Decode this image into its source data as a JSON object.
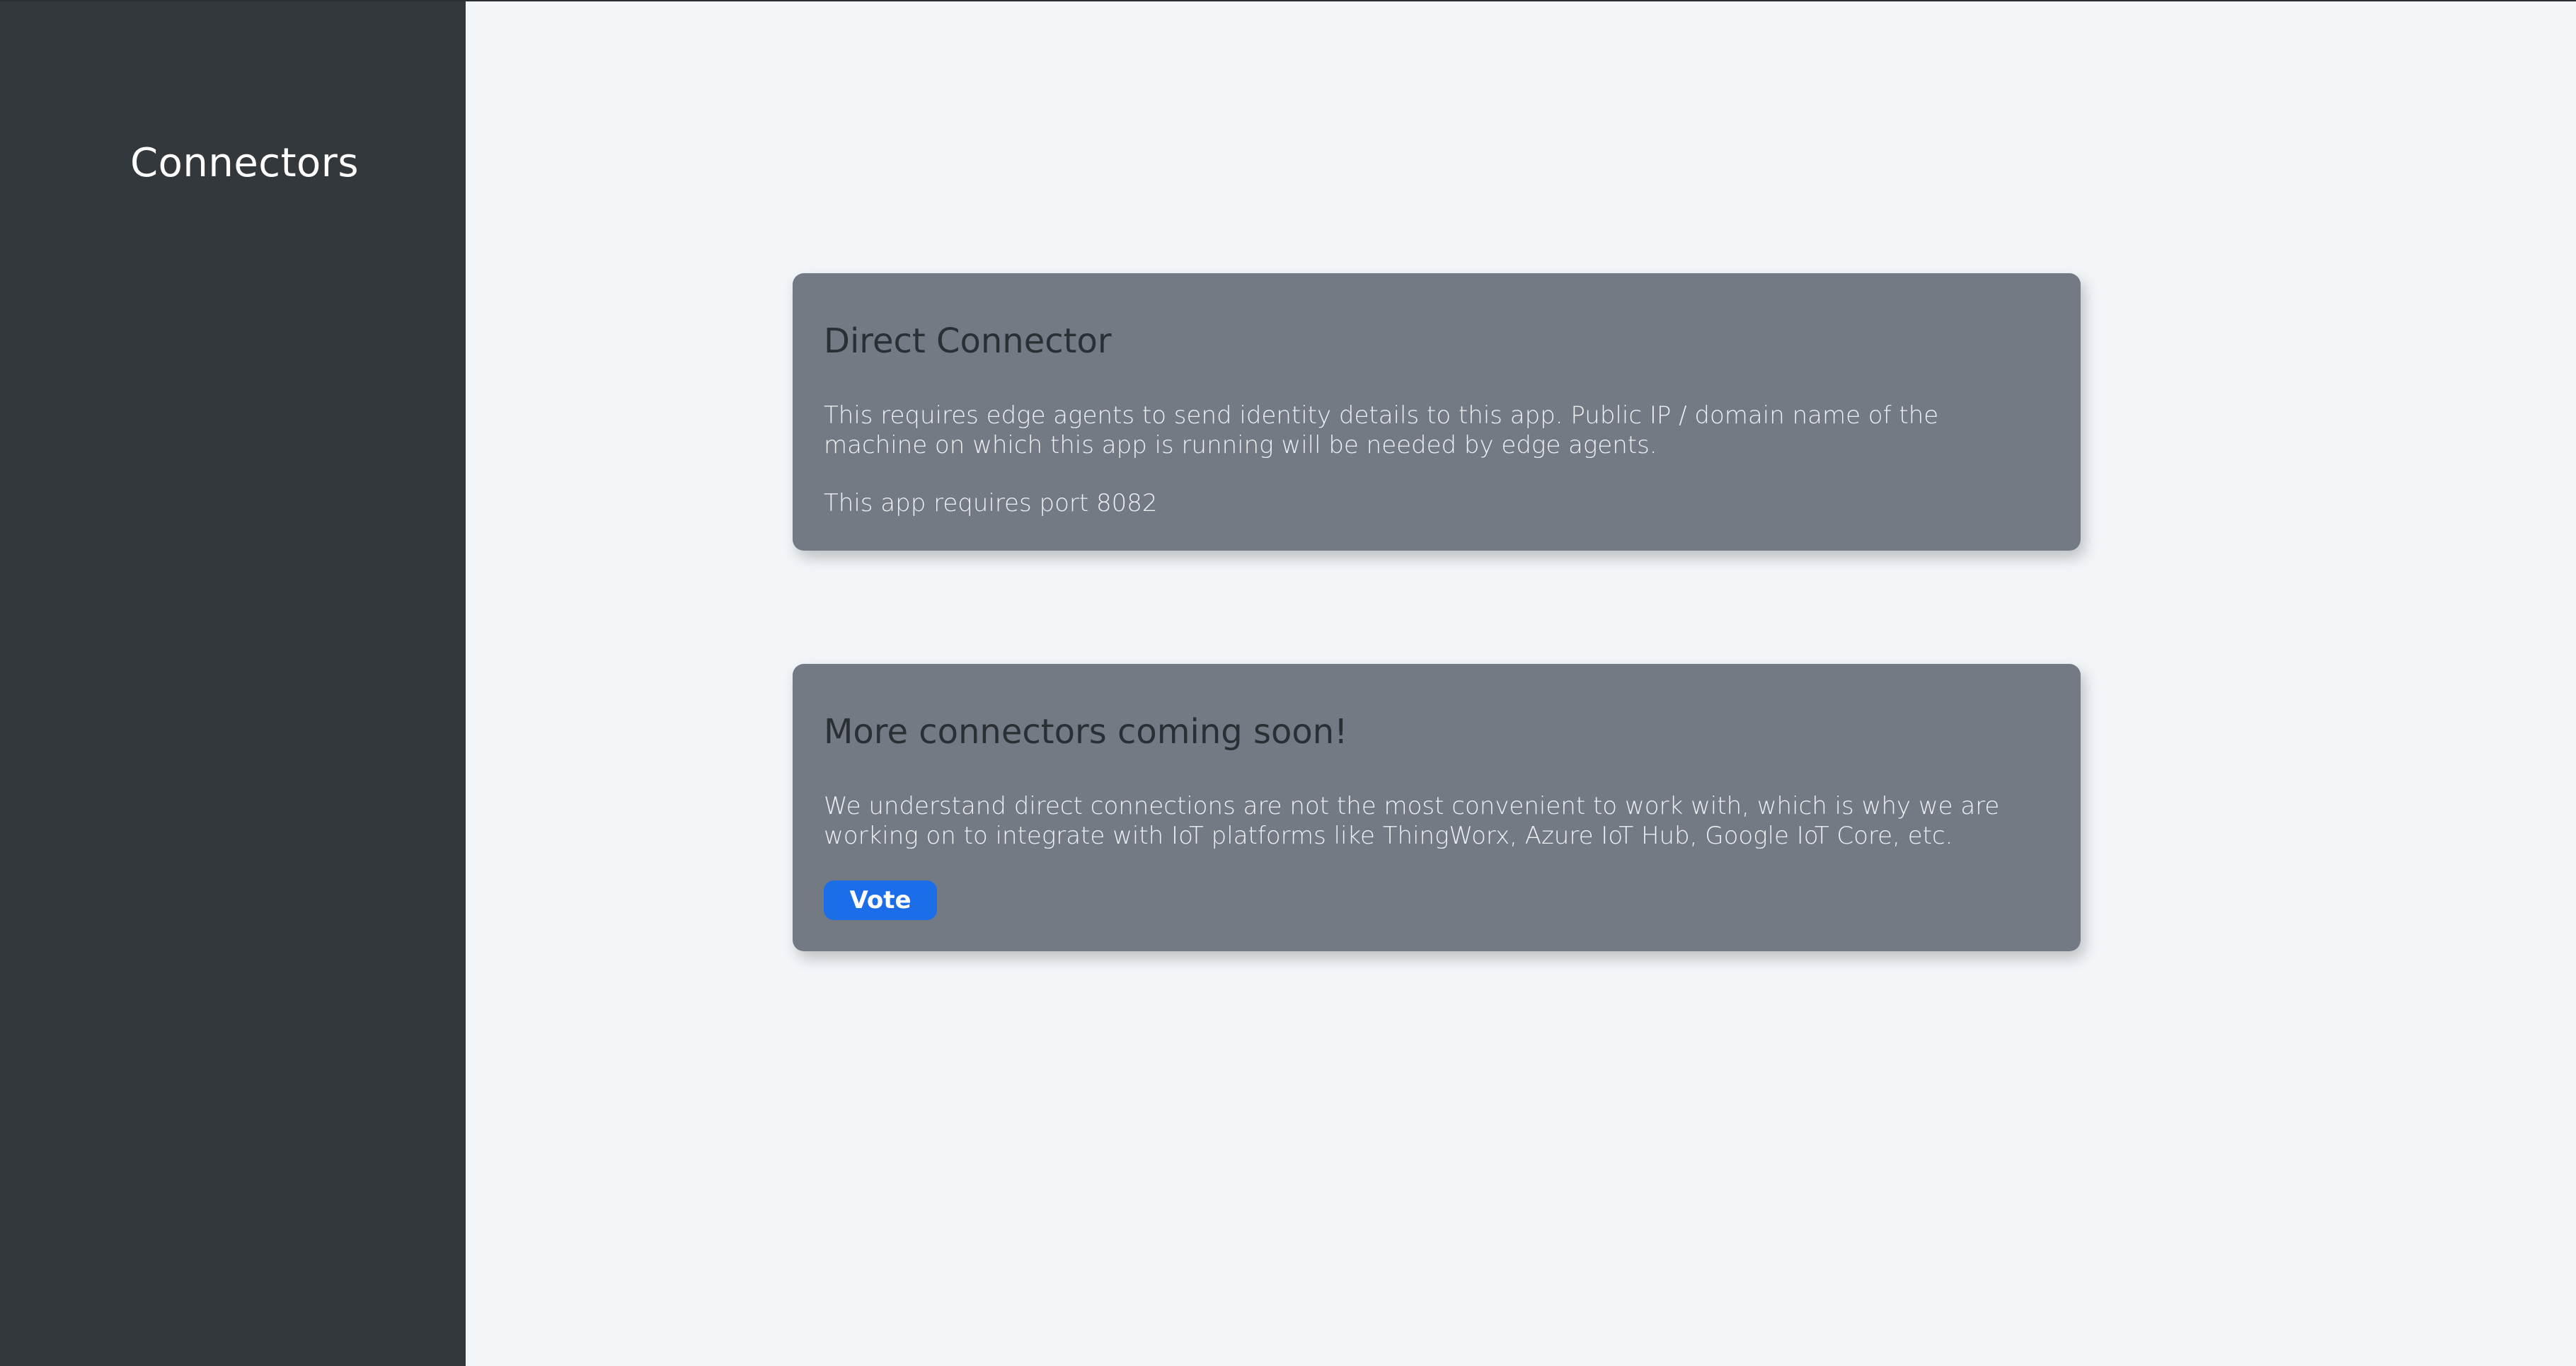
{
  "sidebar": {
    "title": "Connectors"
  },
  "cards": {
    "direct": {
      "title": "Direct Connector",
      "description": "This requires edge agents to send identity details to this app. Public IP / domain name of the machine on which this app is running will be needed by edge agents.",
      "port_note": "This app requires port 8082"
    },
    "more": {
      "title": "More connectors coming soon!",
      "description": "We understand direct connections are not the most convenient to work with, which is why we are working on to integrate with IoT platforms like ThingWorx, Azure IoT Hub, Google IoT Core, etc.",
      "vote_label": "Vote"
    }
  },
  "colors": {
    "sidebar_bg": "#33383c",
    "page_bg": "#f2f6f9",
    "card_bg": "#737a84",
    "accent": "#1b6de8"
  }
}
